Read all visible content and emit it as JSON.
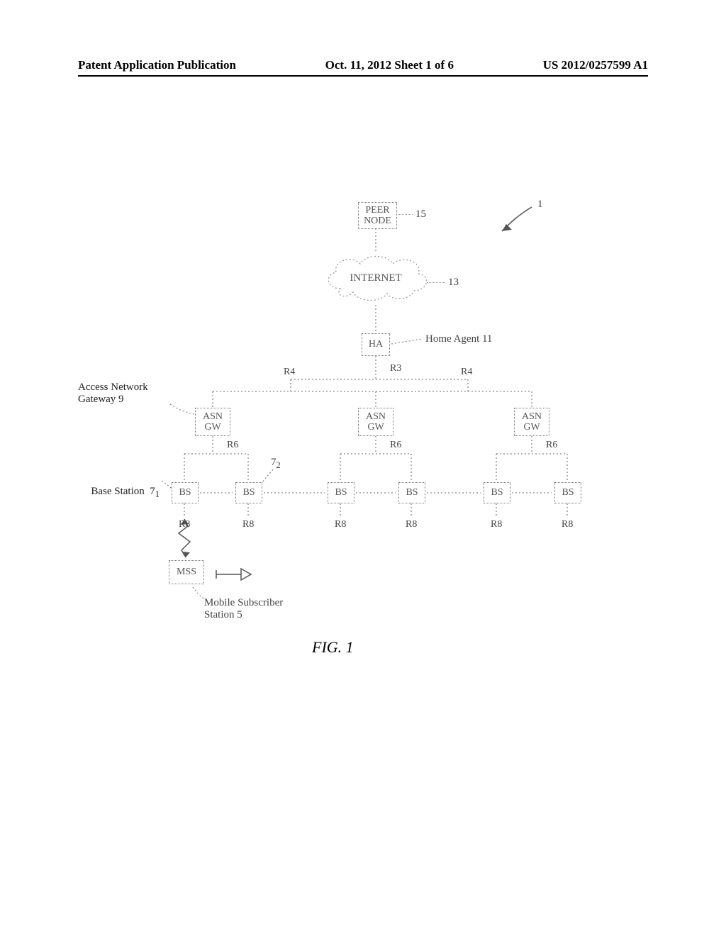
{
  "header": {
    "left": "Patent Application Publication",
    "center": "Oct. 11, 2012  Sheet 1 of 6",
    "right": "US 2012/0257599 A1"
  },
  "diagram": {
    "fig_ref": "1",
    "peer_node": "PEER\nNODE",
    "peer_ref": "15",
    "internet": "INTERNET",
    "internet_ref": "13",
    "ha": "HA",
    "ha_label": "Home Agent 11",
    "r3": "R3",
    "r4_left": "R4",
    "r4_right": "R4",
    "asn_gw_label": "Access Network\nGateway 9",
    "asn_gw": "ASN\nGW",
    "r6": "R6",
    "bs_label_row": "Base Station",
    "bs_ref1": "7",
    "bs_sub1": "1",
    "bs_ref2": "7",
    "bs_sub2": "2",
    "bs": "BS",
    "r8": "R8",
    "mss": "MSS",
    "mss_label": "Mobile Subscriber\nStation 5"
  },
  "caption": "FIG. 1"
}
